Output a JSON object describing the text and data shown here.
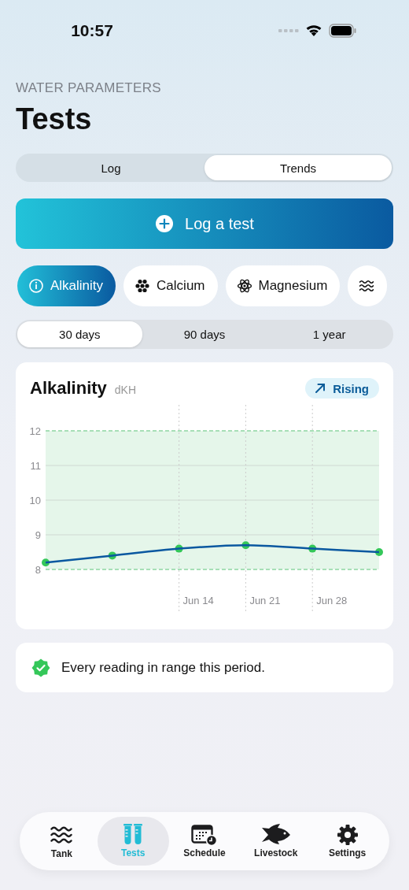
{
  "status_bar": {
    "time": "10:57"
  },
  "header": {
    "eyebrow": "WATER PARAMETERS",
    "title": "Tests"
  },
  "view_tabs": [
    {
      "label": "Log",
      "selected": false
    },
    {
      "label": "Trends",
      "selected": true
    }
  ],
  "log_button": {
    "label": "Log a test"
  },
  "parameter_chips": [
    {
      "label": "Alkalinity",
      "kind": "info",
      "selected": true
    },
    {
      "label": "Calcium",
      "kind": "dots",
      "selected": false
    },
    {
      "label": "Magnesium",
      "kind": "atom",
      "selected": false
    },
    {
      "kind": "waves",
      "selected": false
    }
  ],
  "period_tabs": [
    {
      "label": "30 days",
      "selected": true
    },
    {
      "label": "90 days",
      "selected": false
    },
    {
      "label": "1 year",
      "selected": false
    }
  ],
  "chart_card": {
    "unit": "dKH",
    "trend": {
      "label": "Rising",
      "kind": "up"
    },
    "chart_data": {
      "type": "line",
      "categories": [
        null,
        null,
        "Jun 14",
        "Jun 21",
        "Jun 28",
        null
      ],
      "grid": true,
      "series": [
        {
          "name": "Alkalinity",
          "color": "#0a58a0",
          "marker": "circle",
          "values": [
            8.2,
            8.4,
            8.6,
            8.7,
            8.6,
            8.5
          ]
        }
      ],
      "ylim": [
        8,
        12
      ],
      "yticks": [
        8,
        9,
        10,
        11,
        12
      ],
      "bands": [
        {
          "axis": "y",
          "from": 8,
          "to": 12
        }
      ]
    }
  },
  "status_note": {
    "text": "Every reading in range this period.",
    "ok": true
  },
  "tab_bar": [
    {
      "label": "Tank",
      "kind": "waves",
      "selected": false
    },
    {
      "label": "Tests",
      "kind": "tubes",
      "selected": true
    },
    {
      "label": "Schedule",
      "kind": "calendar",
      "selected": false
    },
    {
      "label": "Livestock",
      "kind": "fish",
      "selected": false
    },
    {
      "label": "Settings",
      "kind": "gear",
      "selected": false
    }
  ]
}
